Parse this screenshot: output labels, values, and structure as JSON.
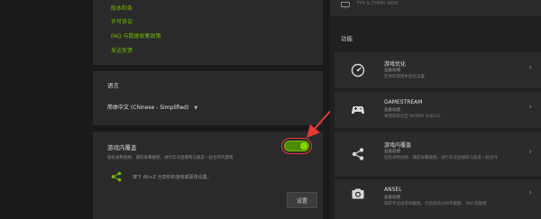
{
  "links": [
    "版本和条",
    "许可协议",
    "FAQ 与数据收集政策",
    "发送反馈"
  ],
  "language": {
    "title": "语言",
    "selected": "简体中文 (Chinese - Simplified)"
  },
  "overlay": {
    "title": "游戏内覆盖",
    "description": "轻松录制视频、捕获屏幕截图，进行实况直播和与朋友一起合作玩游戏",
    "share_hint": "按下 Alt+Z 分享你的游戏或更改设置。",
    "settings_label": "设置",
    "toggle_on": true
  },
  "top_strip": {
    "text": "FPS & THING NEW"
  },
  "features_title": "功能",
  "features": [
    {
      "name": "游戏优化",
      "status": "准备就绪",
      "desc": "在你的游戏中优化设置",
      "icon": "speedometer-icon"
    },
    {
      "name": "GAMESTREAM",
      "status": "准备就绪",
      "desc": "将游戏串流至 NVIDIA SHIELD",
      "icon": "gamepad-icon"
    },
    {
      "name": "游戏内覆盖",
      "status": "准备就绪",
      "desc": "轻松录制视频、捕获屏幕截图，进行实况直播和与朋友一起合作",
      "icon": "share-icon"
    },
    {
      "name": "ANSEL",
      "status": "准备就绪",
      "desc": "捕获专业级游戏截图，包括超高分辨率截图、360 度截图",
      "icon": "camera-icon"
    }
  ],
  "colors": {
    "accent": "#76b900",
    "annotation": "#e53935"
  }
}
